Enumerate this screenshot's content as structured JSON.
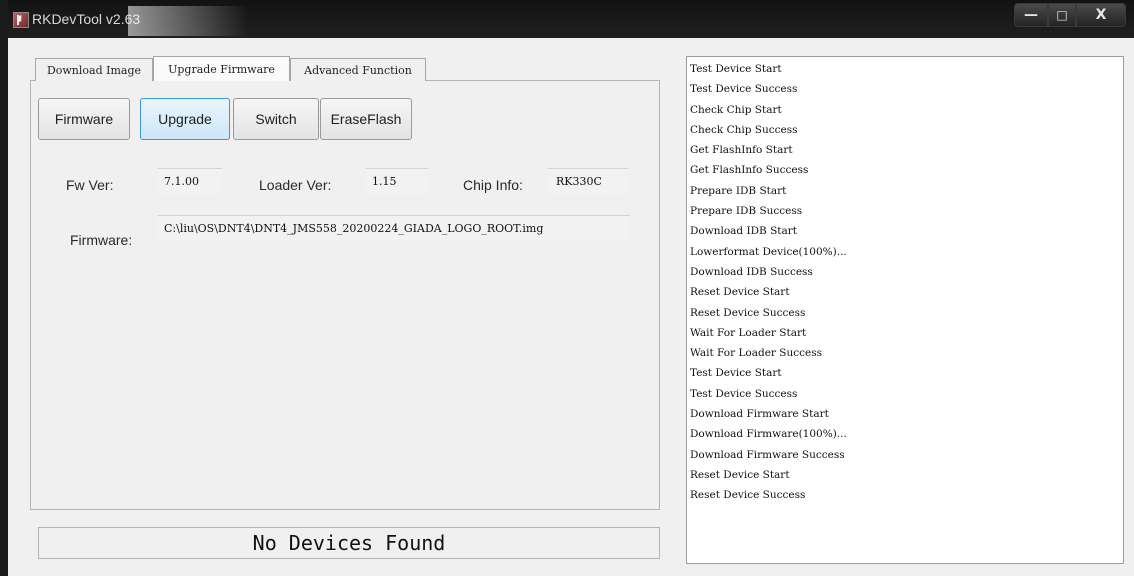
{
  "window": {
    "title": "RKDevTool v2.63",
    "controls": {
      "minimize": "—",
      "maximize": "□",
      "close": "X"
    }
  },
  "tabs": [
    {
      "label": "Download Image",
      "active": false
    },
    {
      "label": "Upgrade Firmware",
      "active": true
    },
    {
      "label": "Advanced Function",
      "active": false
    }
  ],
  "buttons": [
    {
      "label": "Firmware",
      "selected": false
    },
    {
      "label": "Upgrade",
      "selected": true
    },
    {
      "label": "Switch",
      "selected": false
    },
    {
      "label": "EraseFlash",
      "selected": false
    }
  ],
  "info": {
    "fw_ver_label": "Fw Ver:",
    "fw_ver_value": "7.1.00",
    "loader_ver_label": "Loader Ver:",
    "loader_ver_value": "1.15",
    "chip_info_label": "Chip Info:",
    "chip_info_value": "RK330C",
    "firmware_label": "Firmware:",
    "firmware_path": "C:\\liu\\OS\\DNT4\\DNT4_JMS558_20200224_GIADA_LOGO_ROOT.img"
  },
  "status": {
    "text": "No Devices Found"
  },
  "log": [
    "Test Device Start",
    "Test Device Success",
    "Check Chip Start",
    " Check Chip Success",
    "Get FlashInfo Start",
    "Get FlashInfo Success",
    "Prepare IDB Start",
    "Prepare IDB Success",
    "Download IDB Start",
    "Lowerformat Device(100%)...",
    "Download IDB Success",
    "Reset Device Start",
    "Reset Device Success",
    "Wait For Loader Start",
    "Wait For Loader Success",
    "Test Device Start",
    "Test Device Success",
    "Download Firmware Start",
    "Download Firmware(100%)...",
    "Download Firmware Success",
    "Reset Device Start",
    "Reset Device Success"
  ]
}
